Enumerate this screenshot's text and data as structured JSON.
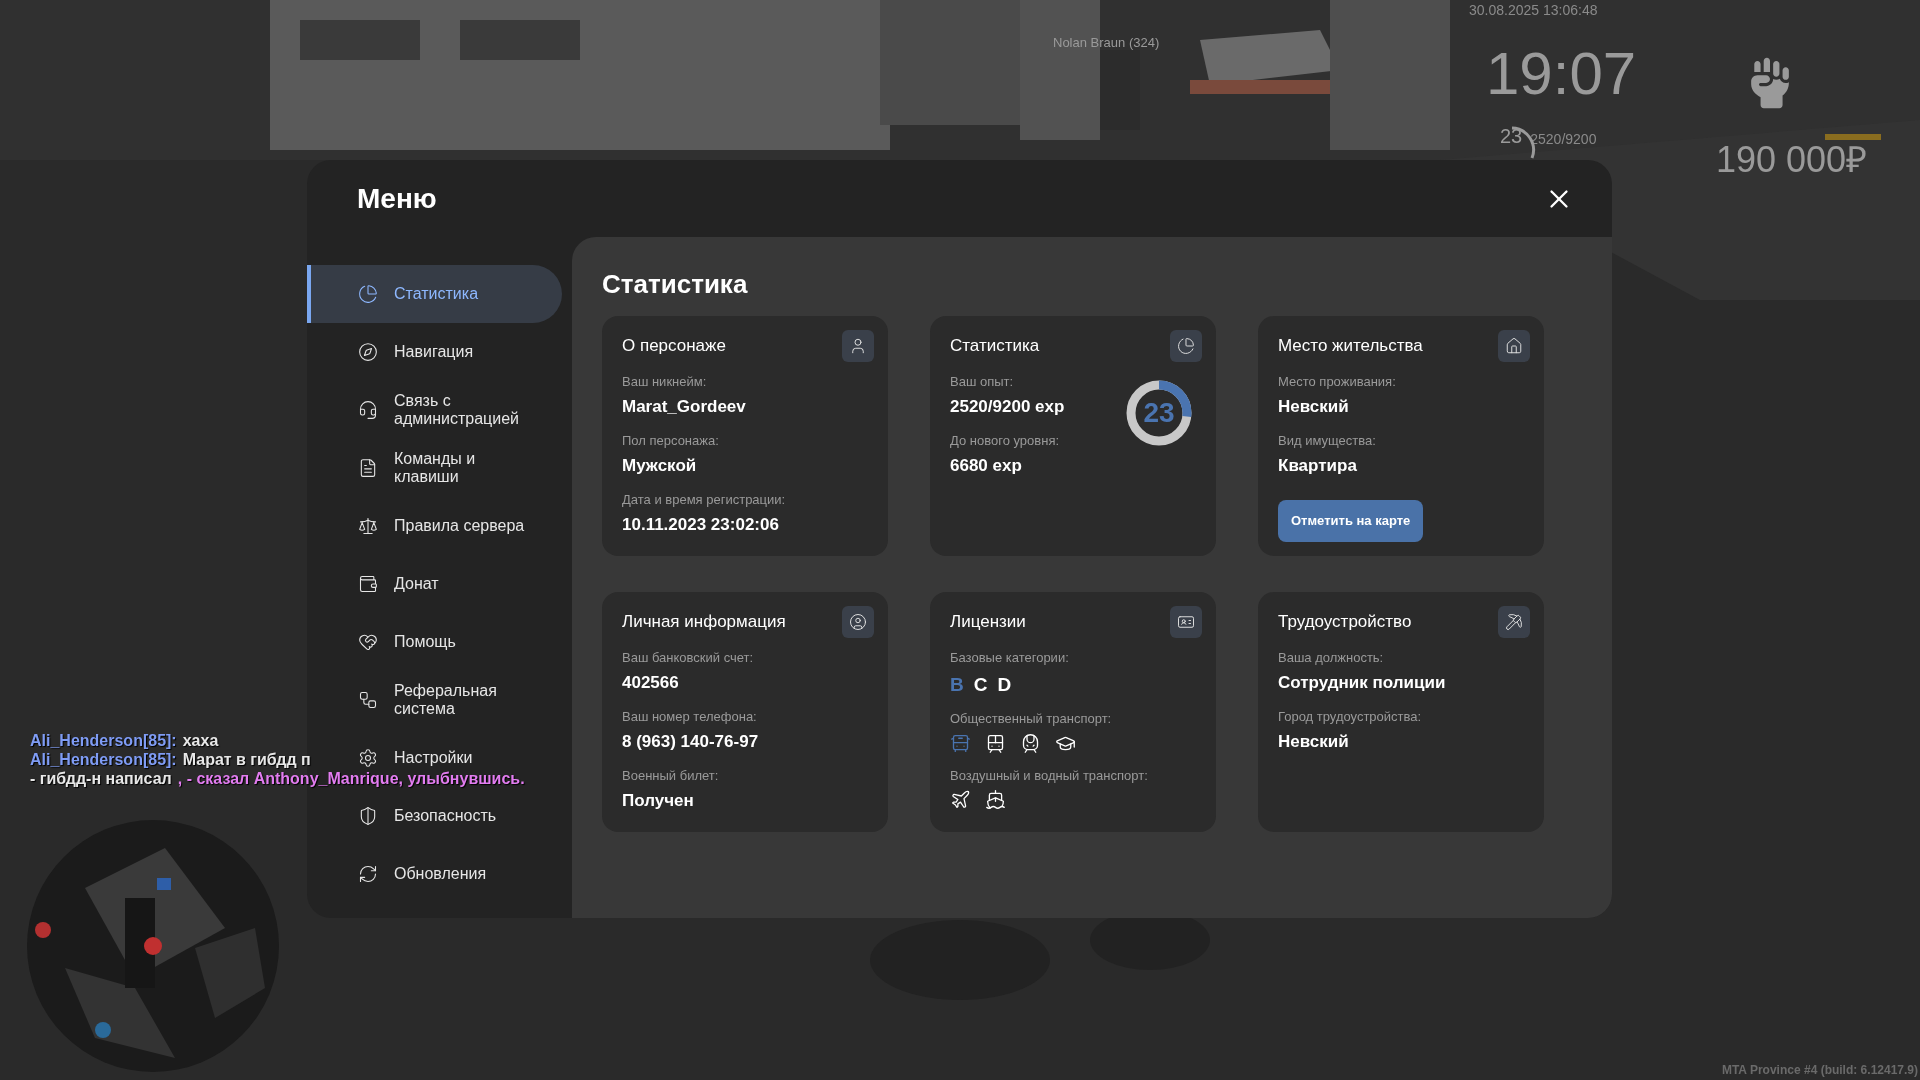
{
  "hud": {
    "player_tag": "Nolan Braun (324)",
    "date_time": "30.08.2025 13:06:48",
    "clock": "19:07",
    "level": "23",
    "exp": "2520/9200",
    "money": "190 000₽"
  },
  "chat": [
    {
      "parts": [
        {
          "kind": "name",
          "text": "Ali_Henderson[85]:"
        },
        {
          "kind": "text",
          "text": "хаха"
        }
      ]
    },
    {
      "parts": [
        {
          "kind": "name",
          "text": "Ali_Henderson[85]:"
        },
        {
          "kind": "text",
          "text": "Марат в гибдд п"
        }
      ]
    },
    {
      "parts": [
        {
          "kind": "text",
          "text": "- гибдд-н написал"
        },
        {
          "kind": "action",
          "text": ", - сказал Anthony_Manrique, улыбнувшись."
        }
      ]
    }
  ],
  "menu": {
    "title": "Меню",
    "sidebar": {
      "items": [
        {
          "label": "Статистика",
          "selected": true
        },
        {
          "label": "Навигация",
          "selected": false
        },
        {
          "label": "Связь с администрацией",
          "selected": false
        },
        {
          "label": "Команды и клавиши",
          "selected": false
        },
        {
          "label": "Правила сервера",
          "selected": false
        },
        {
          "label": "Донат",
          "selected": false
        },
        {
          "label": "Помощь",
          "selected": false
        },
        {
          "label": "Реферальная система",
          "selected": false
        },
        {
          "label": "Настройки",
          "selected": false
        },
        {
          "label": "Безопасность",
          "selected": false
        },
        {
          "label": "Обновления",
          "selected": false
        }
      ]
    },
    "content": {
      "title": "Статистика",
      "cards": [
        {
          "kind": "info",
          "title": "О персонаже",
          "fields": [
            {
              "label": "Ваш никнейм:",
              "value": "Marat_Gordeev"
            },
            {
              "label": "Пол персонажа:",
              "value": "Мужской"
            },
            {
              "label": "Дата и время регистрации:",
              "value": "10.11.2023 23:02:06"
            }
          ]
        },
        {
          "kind": "stats",
          "title": "Статистика",
          "fields": [
            {
              "label": "Ваш опыт:",
              "value": "2520/9200 exp"
            },
            {
              "label": "До нового уровня:",
              "value": "6680 exp"
            }
          ],
          "ring": {
            "text": "23",
            "level": 0.27
          }
        },
        {
          "kind": "residence",
          "title": "Место жительства",
          "fields": [
            {
              "label": "Место проживания:",
              "value": "Невский"
            },
            {
              "label": "Вид имущества:",
              "value": "Квартира"
            }
          ],
          "button": "Отметить на карте"
        },
        {
          "kind": "info",
          "title": "Личная информация",
          "fields": [
            {
              "label": "Ваш банковский счет:",
              "value": "402566"
            },
            {
              "label": "Ваш номер телефона:",
              "value": "8 (963) 140-76-97"
            },
            {
              "label": "Военный билет:",
              "value": "Получен"
            }
          ]
        },
        {
          "kind": "licenses",
          "title": "Лицензии",
          "categories_label": "Базовые категории:",
          "categories": [
            {
              "text": "B",
              "highlighted": true
            },
            {
              "text": "C",
              "highlighted": false
            },
            {
              "text": "D",
              "highlighted": false
            }
          ],
          "public_label": "Общественный транспорт:",
          "public_transport": [
            {
              "highlighted": true
            },
            {
              "highlighted": false
            },
            {
              "highlighted": false
            },
            {
              "highlighted": false
            }
          ],
          "air_label": "Воздушный и водный транспорт:",
          "air_water": [
            {
              "highlighted": false
            },
            {
              "highlighted": false
            }
          ]
        },
        {
          "kind": "info",
          "title": "Трудоустройство",
          "fields": [
            {
              "label": "Ваша должность:",
              "value": "Сотрудник полиции"
            },
            {
              "label": "Город трудоустройства:",
              "value": "Невский"
            }
          ]
        }
      ]
    }
  },
  "build_info": "MTA Province #4 (build: 6.12417.9)"
}
